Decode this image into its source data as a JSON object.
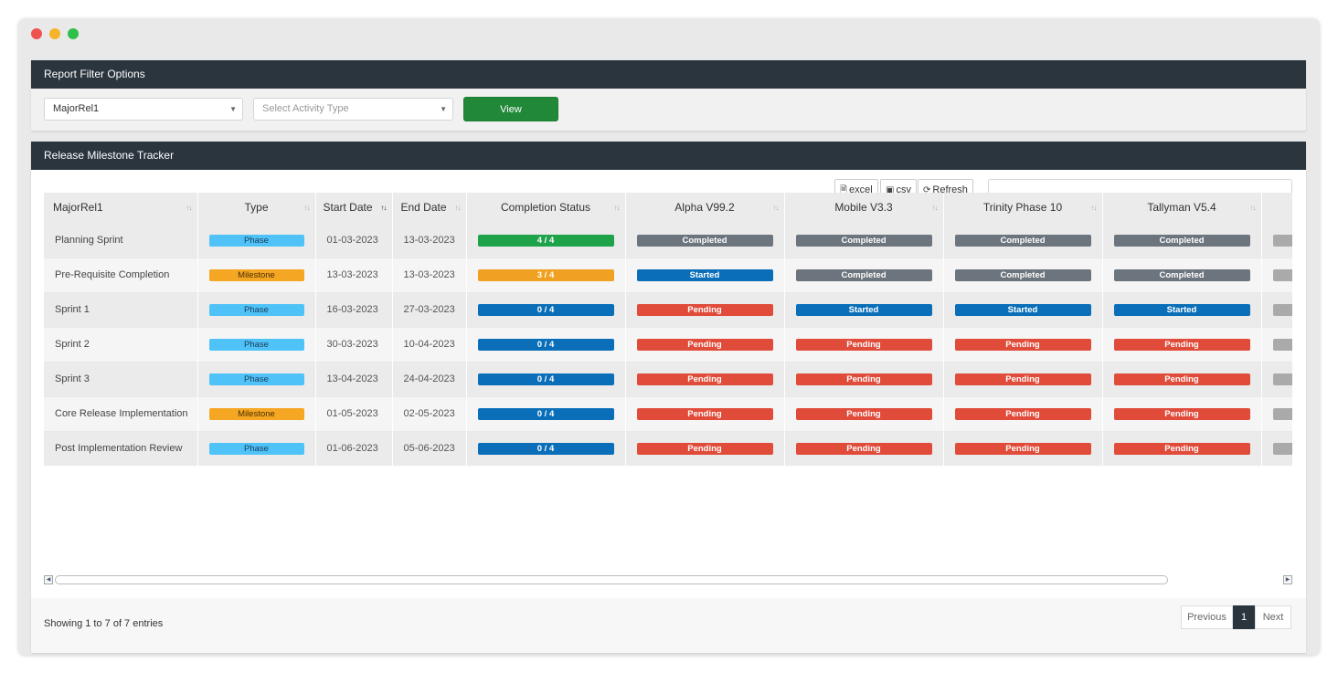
{
  "window": {
    "controls": {
      "close_color": "#ff5f57",
      "minimize_color": "#febc2e",
      "maximize_color": "#28c840"
    }
  },
  "filter": {
    "title": "Report Filter Options",
    "release_select": "MajorRel1",
    "activity_placeholder": "Select Activity Type",
    "view_label": "View"
  },
  "tracker": {
    "title": "Release Milestone Tracker",
    "buttons": {
      "excel": "excel",
      "csv": "csv",
      "refresh": "Refresh"
    },
    "search_value": "",
    "columns": [
      "MajorRel1",
      "Type",
      "Start Date",
      "End Date",
      "Completion Status",
      "Alpha V99.2",
      "Mobile V3.3",
      "Trinity Phase 10",
      "Tallyman V5.4"
    ],
    "rows": [
      {
        "name": "Planning Sprint",
        "type": "Phase",
        "start": "01-03-2023",
        "end": "13-03-2023",
        "completion": "4 / 4",
        "statuses": [
          "Completed",
          "Completed",
          "Completed",
          "Completed"
        ]
      },
      {
        "name": "Pre-Requisite Completion",
        "type": "Milestone",
        "start": "13-03-2023",
        "end": "13-03-2023",
        "completion": "3 / 4",
        "statuses": [
          "Started",
          "Completed",
          "Completed",
          "Completed"
        ]
      },
      {
        "name": "Sprint 1",
        "type": "Phase",
        "start": "16-03-2023",
        "end": "27-03-2023",
        "completion": "0 / 4",
        "statuses": [
          "Pending",
          "Started",
          "Started",
          "Started"
        ]
      },
      {
        "name": "Sprint 2",
        "type": "Phase",
        "start": "30-03-2023",
        "end": "10-04-2023",
        "completion": "0 / 4",
        "statuses": [
          "Pending",
          "Pending",
          "Pending",
          "Pending"
        ]
      },
      {
        "name": "Sprint 3",
        "type": "Phase",
        "start": "13-04-2023",
        "end": "24-04-2023",
        "completion": "0 / 4",
        "statuses": [
          "Pending",
          "Pending",
          "Pending",
          "Pending"
        ]
      },
      {
        "name": "Core Release Implementation",
        "type": "Milestone",
        "start": "01-05-2023",
        "end": "02-05-2023",
        "completion": "0 / 4",
        "statuses": [
          "Pending",
          "Pending",
          "Pending",
          "Pending"
        ]
      },
      {
        "name": "Post Implementation Review",
        "type": "Phase",
        "start": "01-06-2023",
        "end": "05-06-2023",
        "completion": "0 / 4",
        "statuses": [
          "Pending",
          "Pending",
          "Pending",
          "Pending"
        ]
      }
    ],
    "info": "Showing 1 to 7 of 7 entries",
    "pagination": {
      "previous": "Previous",
      "current": "1",
      "next": "Next"
    }
  },
  "colors": {
    "header_bg": "#2a353e",
    "view_button": "#218838",
    "completed": "#6c757d",
    "started": "#0a6fb8",
    "pending": "#e04b3a",
    "phase": "#4fc3f7",
    "milestone": "#f5a623",
    "completion_full": "#1ea34a",
    "completion_partial": "#f0a122",
    "completion_zero": "#0a6fb8"
  }
}
